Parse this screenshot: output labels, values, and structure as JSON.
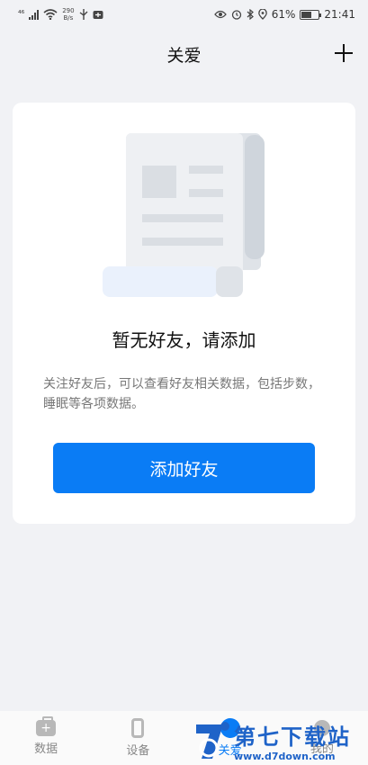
{
  "status_bar": {
    "sim_label": "⁴⁶",
    "net_speed_value": "290",
    "net_speed_unit": "B/s",
    "battery_percent": "61%",
    "time": "21:41"
  },
  "header": {
    "title": "关爱"
  },
  "empty_state": {
    "title": "暂无好友，请添加",
    "description": "关注好友后，可以查看好友相关数据，包括步数，睡眠等各项数据。",
    "button_label": "添加好友"
  },
  "tabbar": {
    "tabs": [
      {
        "label": "数据",
        "icon": "medical-kit-icon"
      },
      {
        "label": "设备",
        "icon": "watch-icon"
      },
      {
        "label": "关爱",
        "icon": "care-icon"
      },
      {
        "label": "我的",
        "icon": "person-icon"
      }
    ],
    "active_index": 2
  },
  "watermark": {
    "brand_cn": "第七下载站",
    "url": "www.d7down.com"
  },
  "colors": {
    "accent": "#0a7cf5",
    "background": "#f1f2f5",
    "card": "#ffffff",
    "watermark": "#1f63c8"
  }
}
